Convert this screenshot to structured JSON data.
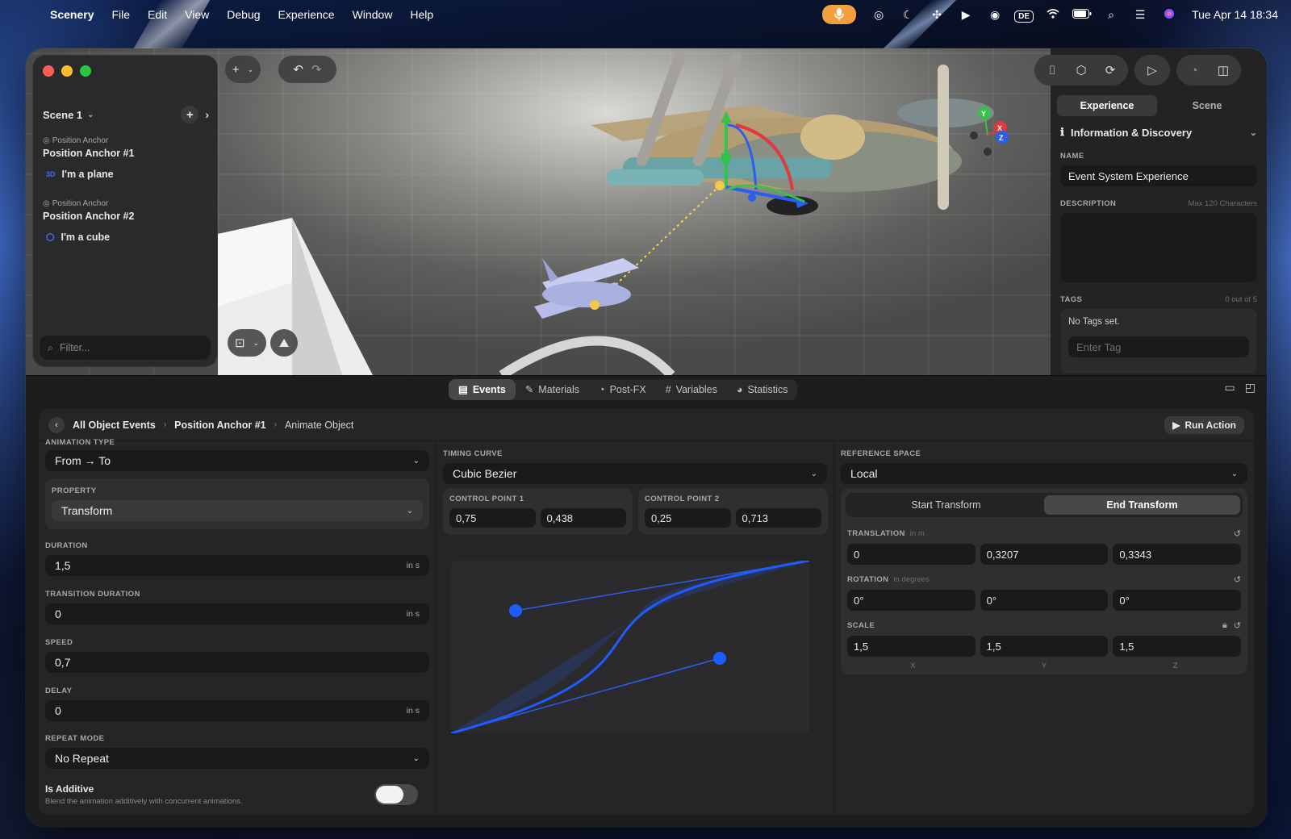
{
  "menubar": {
    "apple": "",
    "app_name": "Scenery",
    "items": [
      "File",
      "Edit",
      "View",
      "Debug",
      "Experience",
      "Window",
      "Help"
    ],
    "keyboard_layout": "DE",
    "clock": "Tue Apr 14  18:34"
  },
  "outliner": {
    "scene_name": "Scene 1",
    "anchors": [
      {
        "caption": "Position Anchor",
        "title": "Position Anchor #1",
        "child_badge": "3D",
        "child_label": "I'm a plane"
      },
      {
        "caption": "Position Anchor",
        "title": "Position Anchor #2",
        "child_label": "I'm a cube"
      }
    ],
    "filter_placeholder": "Filter..."
  },
  "inspector": {
    "tabs": [
      "Experience",
      "Scene"
    ],
    "active_tab": "Experience",
    "section_title": "Information & Discovery",
    "name_label": "NAME",
    "name_value": "Event System Experience",
    "description_label": "DESCRIPTION",
    "description_hint": "Max 120 Characters",
    "tags_label": "TAGS",
    "tags_count": "0 out of 5",
    "tags_empty": "No Tags set.",
    "tag_placeholder": "Enter Tag"
  },
  "bottom_tabs": {
    "items": [
      {
        "icon": "▤",
        "label": "Events"
      },
      {
        "icon": "✎",
        "label": "Materials"
      },
      {
        "icon": "◔",
        "label": "Post-FX"
      },
      {
        "icon": "#",
        "label": "Variables"
      },
      {
        "icon": "◕",
        "label": "Statistics"
      }
    ],
    "active": "Events"
  },
  "events": {
    "breadcrumb": [
      "All Object Events",
      "Position Anchor #1",
      "Animate Object"
    ],
    "run_action": "Run Action",
    "animation_type_label": "ANIMATION TYPE",
    "animation_type": "From → To",
    "property_label": "PROPERTY",
    "property": "Transform",
    "duration_label": "DURATION",
    "duration": "1,5",
    "transition_duration_label": "TRANSITION DURATION",
    "transition_duration": "0",
    "speed_label": "SPEED",
    "speed": "0,7",
    "delay_label": "DELAY",
    "delay": "0",
    "unit_seconds": "in s",
    "repeat_mode_label": "REPEAT MODE",
    "repeat_mode": "No Repeat",
    "is_additive_label": "Is Additive",
    "is_additive_desc": "Blend the animation additively with concurrent animations.",
    "timing_curve_label": "TIMING CURVE",
    "timing_curve": "Cubic Bezier",
    "cp1_label": "CONTROL POINT 1",
    "cp1": [
      "0,75",
      "0,438"
    ],
    "cp2_label": "CONTROL POINT 2",
    "cp2": [
      "0,25",
      "0,713"
    ],
    "reference_space_label": "REFERENCE SPACE",
    "reference_space": "Local",
    "transform_tabs": [
      "Start Transform",
      "End Transform"
    ],
    "active_transform_tab": "End Transform",
    "translation_label": "TRANSLATION",
    "translation_unit": "in m",
    "translation": [
      "0",
      "0,3207",
      "0,3343"
    ],
    "rotation_label": "ROTATION",
    "rotation_unit": "in degrees",
    "rotation": [
      "0°",
      "0°",
      "0°"
    ],
    "scale_label": "SCALE",
    "scale": [
      "1,5",
      "1,5",
      "1,5"
    ],
    "axes": [
      "X",
      "Y",
      "Z"
    ]
  },
  "gizmo_axes": [
    "Y",
    "X",
    "Z"
  ],
  "colors": {
    "accent_blue": "#1f5cff",
    "mic_orange": "#f5a142",
    "traffic_red": "#ff5f57",
    "traffic_yellow": "#febc2e",
    "traffic_green": "#28c840"
  }
}
